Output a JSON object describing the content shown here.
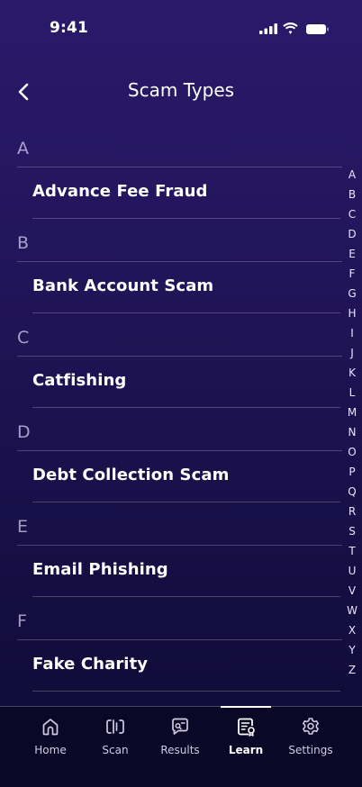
{
  "status_bar": {
    "time": "9:41",
    "icons": [
      "signal-icon",
      "wifi-icon",
      "battery-icon"
    ]
  },
  "header": {
    "title": "Scam Types",
    "back_icon": "chevron-left-icon"
  },
  "sections": [
    {
      "letter": "A",
      "items": [
        "Advance Fee Fraud"
      ]
    },
    {
      "letter": "B",
      "items": [
        "Bank Account Scam"
      ]
    },
    {
      "letter": "C",
      "items": [
        "Catfishing"
      ]
    },
    {
      "letter": "D",
      "items": [
        "Debt Collection Scam"
      ]
    },
    {
      "letter": "E",
      "items": [
        "Email Phishing"
      ]
    },
    {
      "letter": "F",
      "items": [
        "Fake Charity"
      ]
    }
  ],
  "alphabet_index": [
    "A",
    "B",
    "C",
    "D",
    "E",
    "F",
    "G",
    "H",
    "I",
    "J",
    "K",
    "L",
    "M",
    "N",
    "O",
    "P",
    "Q",
    "R",
    "S",
    "T",
    "U",
    "V",
    "W",
    "X",
    "Y",
    "Z"
  ],
  "tab_bar": {
    "tabs": [
      {
        "label": "Home",
        "icon": "home-icon"
      },
      {
        "label": "Scan",
        "icon": "scan-icon"
      },
      {
        "label": "Results",
        "icon": "results-icon"
      },
      {
        "label": "Learn",
        "icon": "learn-icon",
        "active": true
      },
      {
        "label": "Settings",
        "icon": "gear-icon"
      }
    ]
  },
  "colors": {
    "background_top": "#2a1a6b",
    "background_bottom": "#0e0a33",
    "tab_bar_background": "#0a0826",
    "text": "#ffffff"
  }
}
